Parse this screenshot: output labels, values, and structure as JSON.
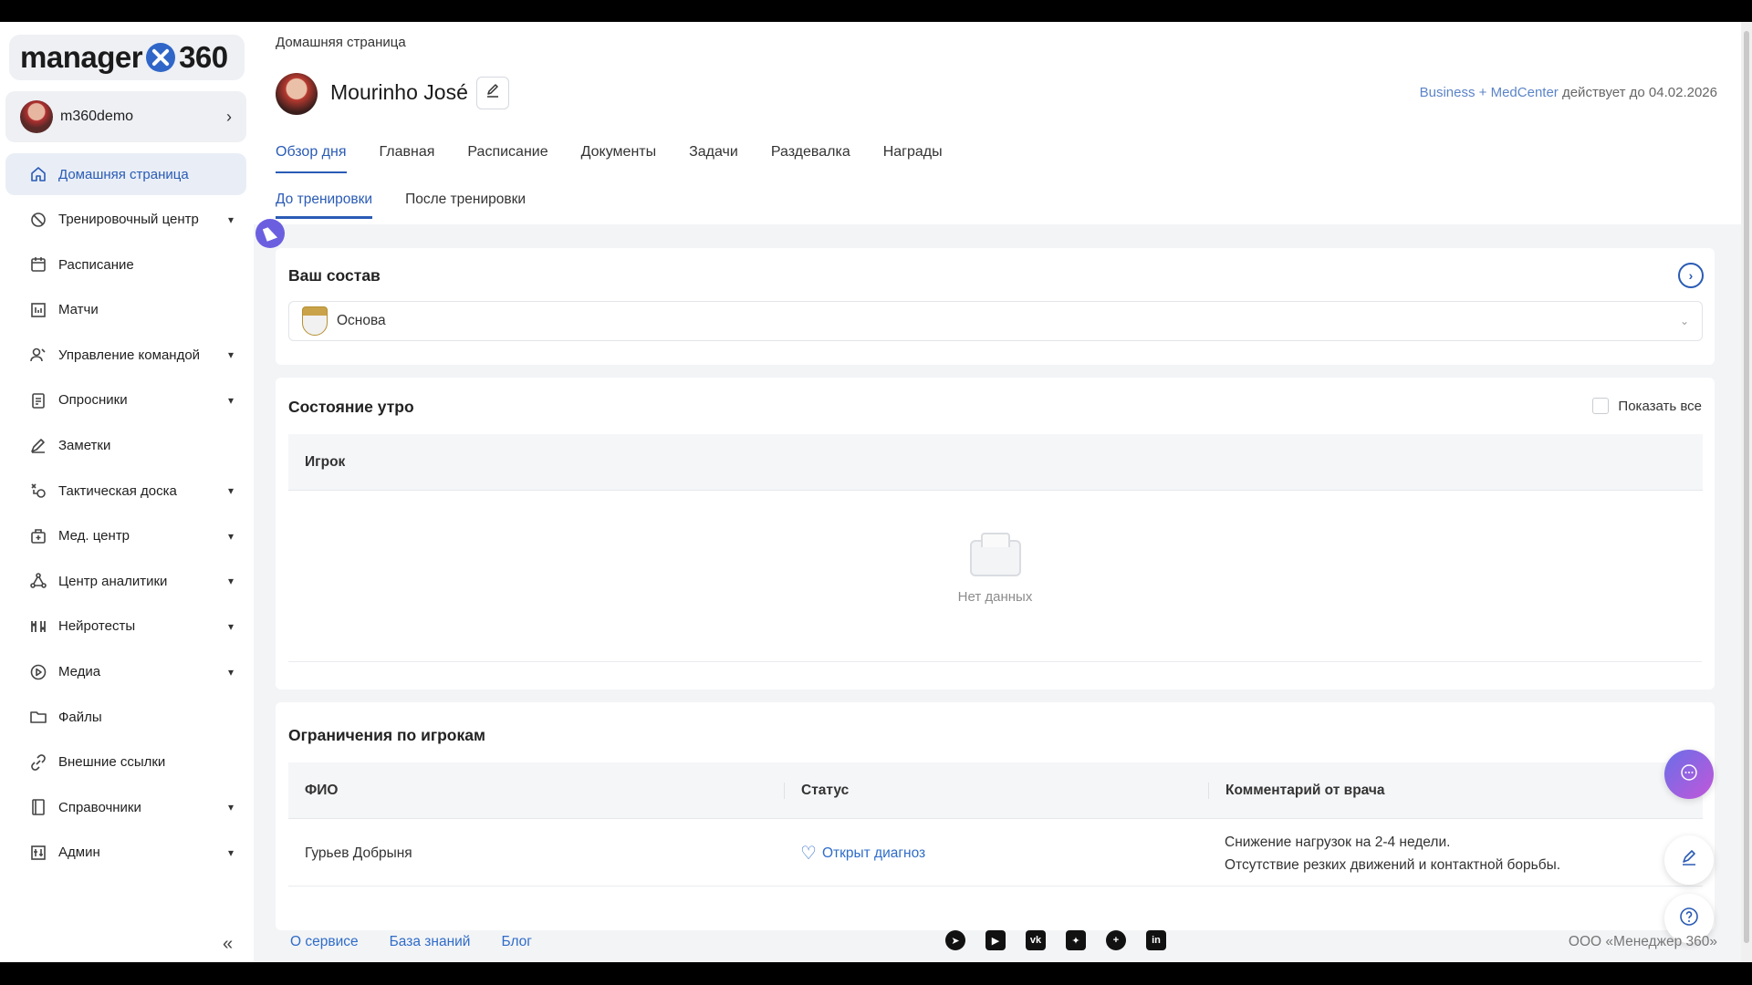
{
  "logo": {
    "text_left": "manager",
    "text_right": "360"
  },
  "user": {
    "username": "m360demo"
  },
  "sidebar": {
    "items": [
      {
        "label": "Домашняя страница",
        "icon": "home-icon",
        "active": true,
        "has_caret": false
      },
      {
        "label": "Тренировочный центр",
        "icon": "dumbbell-icon",
        "has_caret": true
      },
      {
        "label": "Расписание",
        "icon": "calendar-icon",
        "has_caret": false
      },
      {
        "label": "Матчи",
        "icon": "scoreboard-icon",
        "has_caret": false
      },
      {
        "label": "Управление командой",
        "icon": "team-icon",
        "has_caret": true
      },
      {
        "label": "Опросники",
        "icon": "clipboard-icon",
        "has_caret": true
      },
      {
        "label": "Заметки",
        "icon": "pen-icon",
        "has_caret": false
      },
      {
        "label": "Тактическая доска",
        "icon": "tactics-icon",
        "has_caret": true
      },
      {
        "label": "Мед. центр",
        "icon": "medkit-icon",
        "has_caret": true
      },
      {
        "label": "Центр аналитики",
        "icon": "analytics-icon",
        "has_caret": true
      },
      {
        "label": "Нейротесты",
        "icon": "brain-icon",
        "has_caret": true
      },
      {
        "label": "Медиа",
        "icon": "play-icon",
        "has_caret": true
      },
      {
        "label": "Файлы",
        "icon": "folder-icon",
        "has_caret": false
      },
      {
        "label": "Внешние ссылки",
        "icon": "link-icon",
        "has_caret": false
      },
      {
        "label": "Справочники",
        "icon": "book-icon",
        "has_caret": true
      },
      {
        "label": "Админ",
        "icon": "admin-icon",
        "has_caret": true
      }
    ]
  },
  "header": {
    "breadcrumb": "Домашняя страница",
    "profile_name": "Mourinho José",
    "plan_accent": "Business + MedCenter",
    "plan_rest": " действует до 04.02.2026",
    "tabs": [
      "Обзор дня",
      "Главная",
      "Расписание",
      "Документы",
      "Задачи",
      "Раздевалка",
      "Награды"
    ],
    "subtabs": [
      "До тренировки",
      "После тренировки"
    ]
  },
  "squad_card": {
    "title": "Ваш состав",
    "selected": "Основа"
  },
  "morning_card": {
    "title": "Состояние утро",
    "show_all_label": "Показать все",
    "column": "Игрок",
    "empty_text": "Нет данных"
  },
  "restrictions_card": {
    "title": "Ограничения по игрокам",
    "columns": [
      "ФИО",
      "Статус",
      "Комментарий от врача"
    ],
    "rows": [
      {
        "name": "Гурьев Добрыня",
        "status": "Открыт диагноз",
        "comment_line1": "Снижение нагрузок на 2-4 недели.",
        "comment_line2": "Отсутствие резких движений и контактной борьбы."
      }
    ]
  },
  "footer": {
    "links": [
      "О сервисе",
      "База знаний",
      "Блог"
    ],
    "socials": [
      "telegram-icon",
      "youtube-icon",
      "vk-icon",
      "yandex-zen-icon",
      "plus-icon",
      "linkedin-icon"
    ],
    "company": "ООО «Менеджер 360»"
  },
  "colors": {
    "accent": "#2a5bb5",
    "link": "#2f6cc8",
    "chat_gradient_start": "#6a6ee8",
    "chat_gradient_end": "#c257d9"
  }
}
